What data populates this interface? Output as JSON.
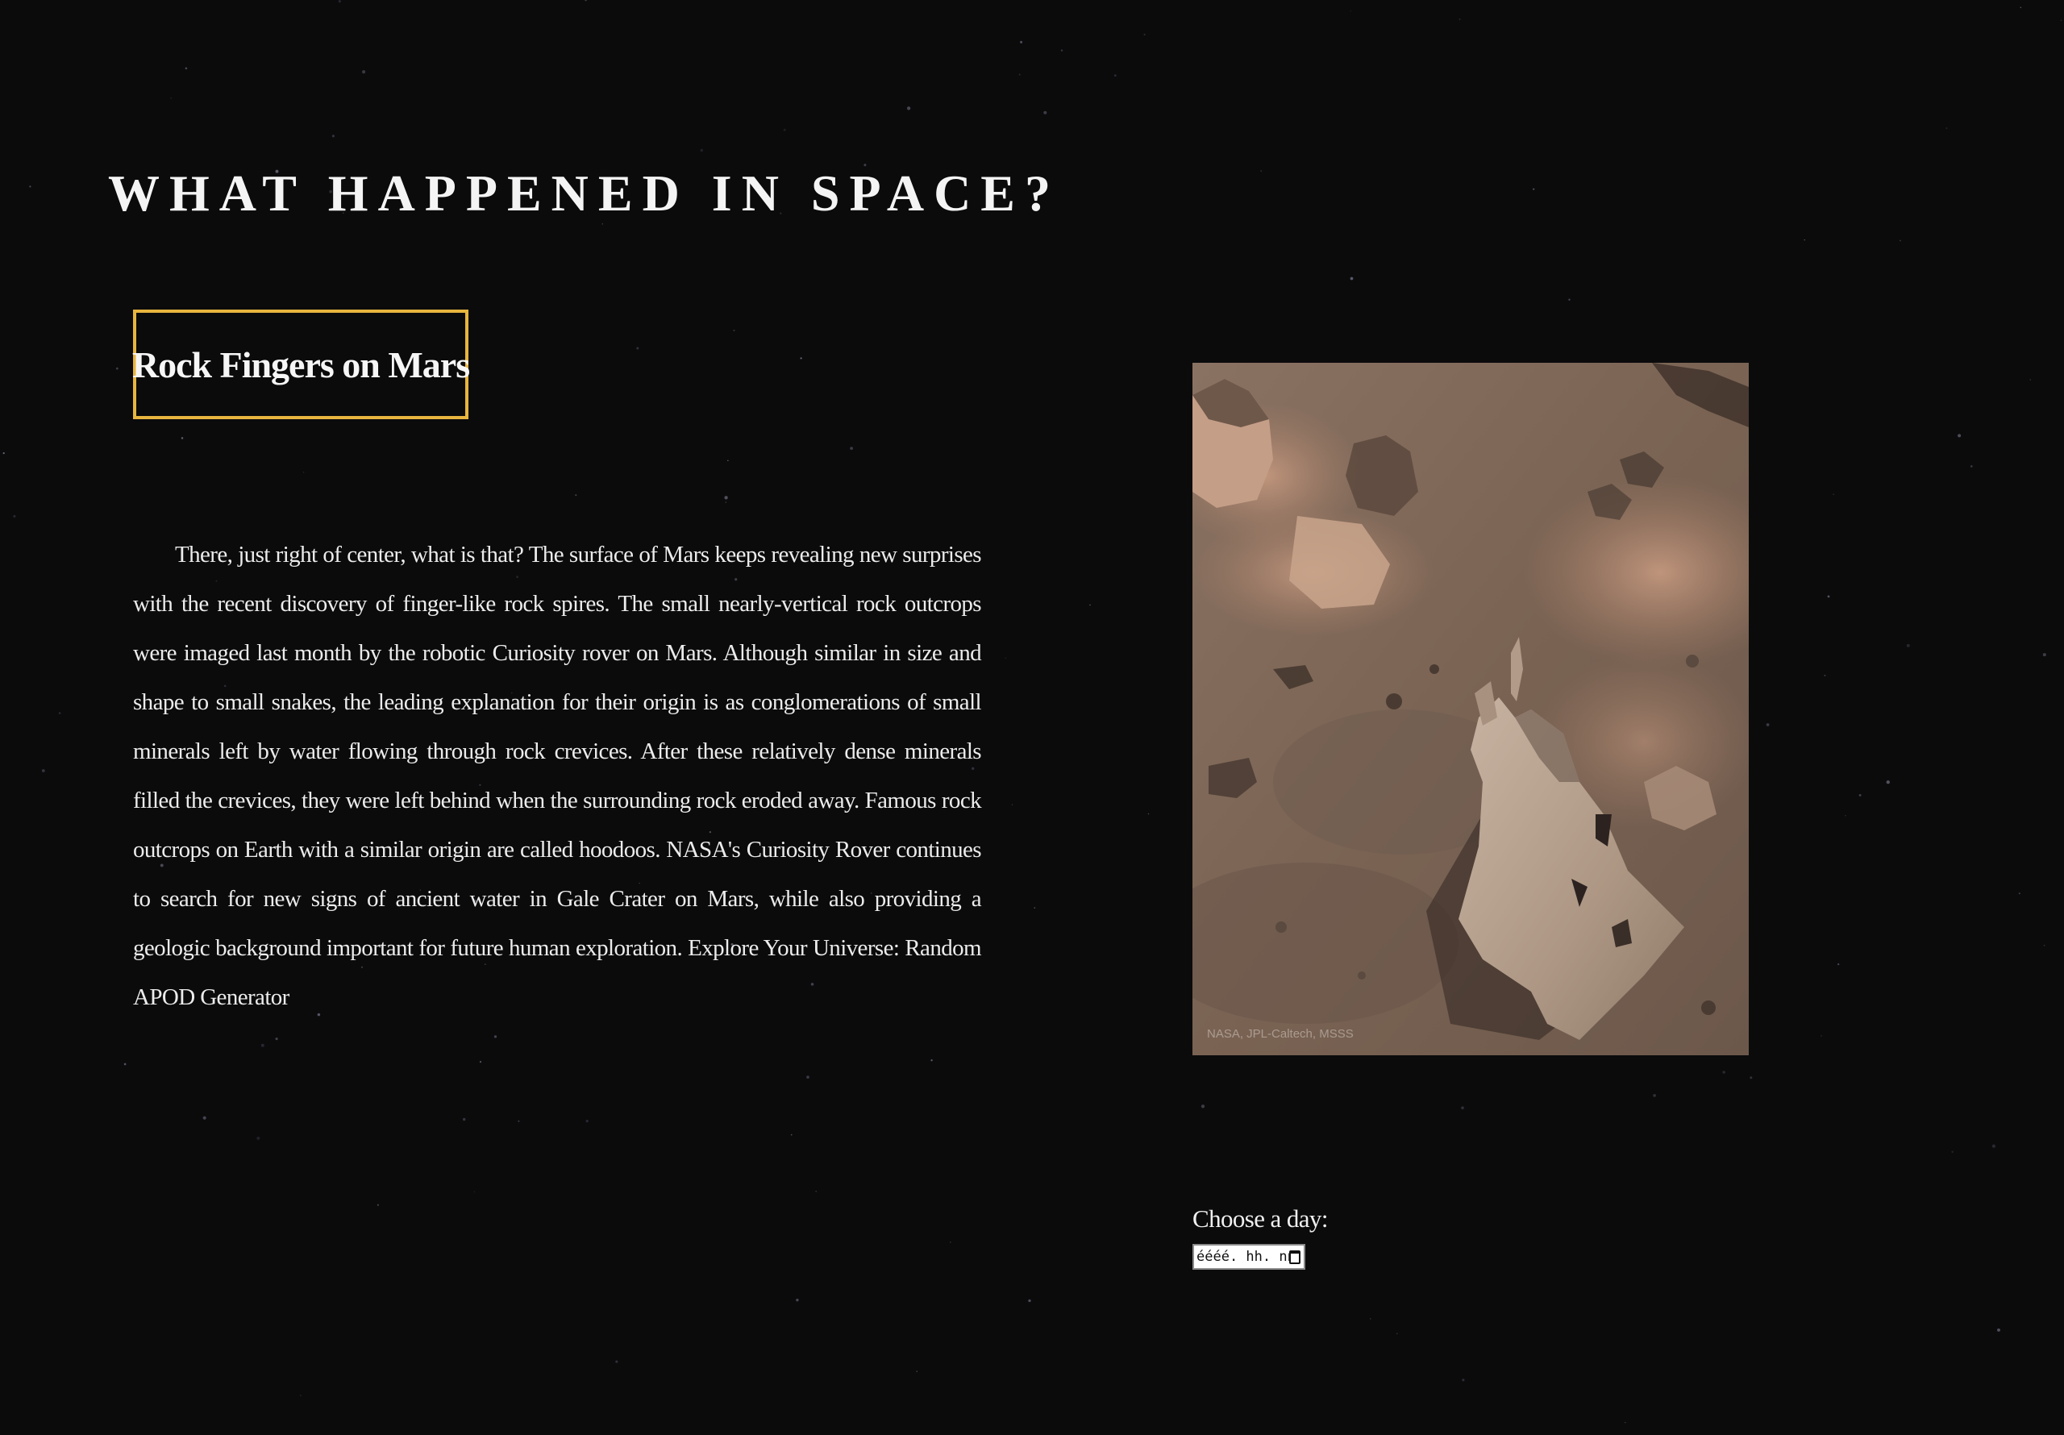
{
  "page": {
    "title": "WHAT HAPPENED IN SPACE?"
  },
  "apod": {
    "title": "Rock Fingers on Mars",
    "explanation": "There, just right of center, what is that? The surface of Mars keeps revealing new surprises with the recent discovery of finger-like rock spires. The small nearly-vertical rock outcrops were imaged last month by the robotic Curiosity rover on Mars. Although similar in size and shape to small snakes, the leading explanation for their origin is as conglomerations of small minerals left by water flowing through rock crevices. After these relatively dense minerals filled the crevices, they were left behind when the surrounding rock eroded away. Famous rock outcrops on Earth with a similar origin are called hoodoos. NASA's Curiosity Rover continues to search for new signs of ancient water in Gale Crater on Mars, while also providing a geologic background important for future human exploration. Explore Your Universe: Random APOD Generator",
    "image_credit": "NASA, JPL-Caltech, MSSS"
  },
  "date_picker": {
    "label": "Choose a day:",
    "placeholder": "éééé. hh. nn."
  },
  "colors": {
    "background": "#0b0b0c",
    "title_box_border": "#e8b53e"
  }
}
